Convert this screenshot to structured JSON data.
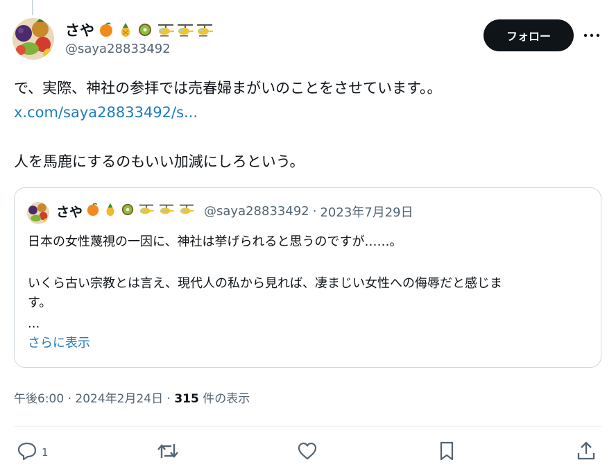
{
  "post": {
    "author": {
      "name": "さや",
      "handle": "@saya28833492",
      "name_emojis": [
        "orange-icon",
        "pineapple-icon",
        "kiwi-icon",
        "helicopter-icon",
        "helicopter-icon",
        "helicopter-icon"
      ]
    },
    "follow_label": "フォロー",
    "body": {
      "line1": "で、実際、神社の参拝では売春婦まがいのことをさせています。。",
      "link": "x.com/saya28833492/s...",
      "line2": "人を馬鹿にするのもいい加減にしろという。"
    },
    "meta": {
      "time": "午後6:00",
      "sep1": " · ",
      "date": "2024年2月24日",
      "sep2": " · ",
      "views": "315",
      "views_label": " 件の表示"
    },
    "actions": {
      "reply_count": "1"
    }
  },
  "quote": {
    "name": "さや",
    "handle": "@saya28833492",
    "dot": "·",
    "date": "2023年7月29日",
    "line1": "日本の女性蔑視の一因に、神社は挙げられると思うのですが……。",
    "line2": "いくら古い宗教とは言え、現代人の私から見れば、凄まじい女性への侮辱だと感じま",
    "line3": "す。",
    "line4": "...",
    "show_more": "さらに表示"
  },
  "colors": {
    "link": "#1d7bbf",
    "follow_bg": "#0f1419",
    "muted": "#536471",
    "border": "#cfd9de"
  }
}
